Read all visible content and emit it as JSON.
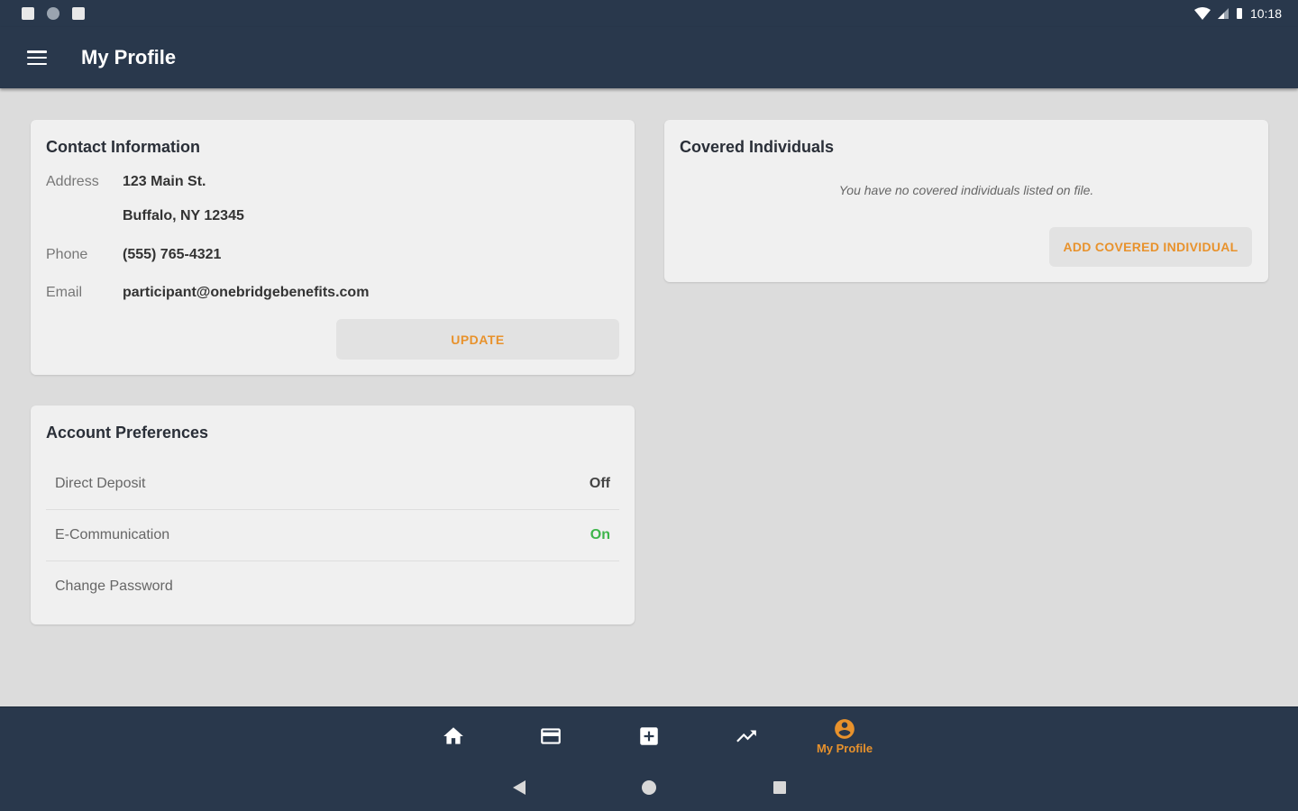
{
  "status_bar": {
    "time": "10:18"
  },
  "app_bar": {
    "title": "My Profile",
    "menu_icon": "hamburger-menu-icon"
  },
  "contact": {
    "title": "Contact Information",
    "address_label": "Address",
    "address_line1": "123 Main St.",
    "address_line2": "Buffalo, NY 12345",
    "phone_label": "Phone",
    "phone": "(555) 765-4321",
    "email_label": "Email",
    "email": "participant@onebridgebenefits.com",
    "update_button": "UPDATE"
  },
  "covered": {
    "title": "Covered Individuals",
    "empty_message": "You have no covered individuals listed on file.",
    "add_button": "ADD COVERED INDIVIDUAL"
  },
  "preferences": {
    "title": "Account Preferences",
    "items": [
      {
        "label": "Direct Deposit",
        "value": "Off"
      },
      {
        "label": "E-Communication",
        "value": "On"
      },
      {
        "label": "Change Password",
        "value": ""
      }
    ]
  },
  "bottom_nav": {
    "items": [
      {
        "icon": "home-icon",
        "label": ""
      },
      {
        "icon": "card-icon",
        "label": ""
      },
      {
        "icon": "medical-plus-icon",
        "label": ""
      },
      {
        "icon": "trending-icon",
        "label": ""
      },
      {
        "icon": "account-circle-icon",
        "label": "My Profile",
        "active": true
      }
    ]
  },
  "colors": {
    "header_bg": "#29384c",
    "accent": "#e8922c",
    "on_green": "#3db54a",
    "page_bg": "#dcdcdc",
    "card_bg": "#f0f0f0"
  }
}
